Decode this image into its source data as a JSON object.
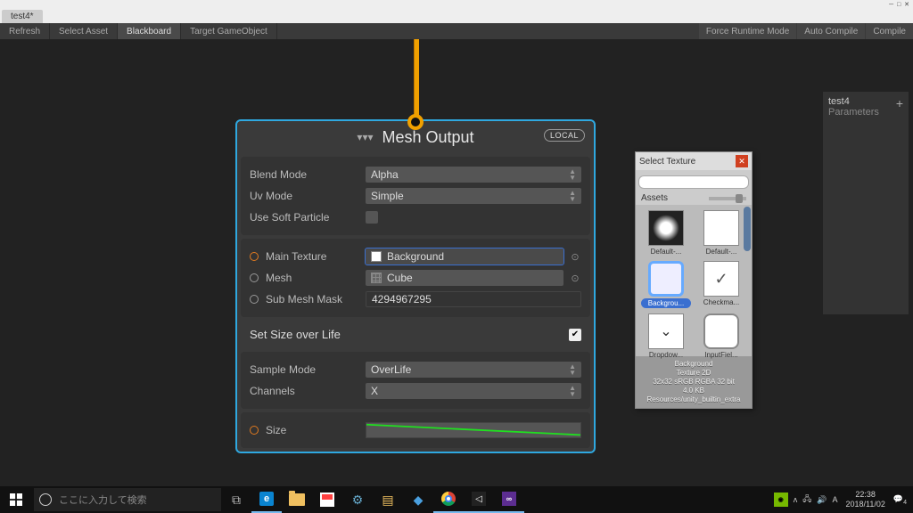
{
  "window": {
    "tab": "test4*"
  },
  "toolbar": {
    "left": [
      "Refresh",
      "Select Asset",
      "Blackboard",
      "Target GameObject"
    ],
    "active_index": 2,
    "right": [
      "Force Runtime Mode",
      "Auto Compile",
      "Compile"
    ]
  },
  "node": {
    "title": "Mesh Output",
    "badge": "LOCAL",
    "rows": {
      "blend_mode_label": "Blend Mode",
      "blend_mode_value": "Alpha",
      "uv_mode_label": "Uv Mode",
      "uv_mode_value": "Simple",
      "soft_particle_label": "Use Soft Particle",
      "soft_particle_checked": false,
      "main_texture_label": "Main Texture",
      "main_texture_value": "Background",
      "mesh_label": "Mesh",
      "mesh_value": "Cube",
      "submesh_label": "Sub Mesh Mask",
      "submesh_value": "4294967295"
    },
    "section": {
      "title": "Set Size over Life",
      "enabled": true,
      "sample_mode_label": "Sample Mode",
      "sample_mode_value": "OverLife",
      "channels_label": "Channels",
      "channels_value": "X",
      "size_label": "Size"
    }
  },
  "inspector": {
    "title": "test4",
    "subtitle": "Parameters"
  },
  "picker": {
    "title": "Select Texture",
    "search_placeholder": "",
    "tab": "Assets",
    "items": [
      {
        "label": "Default-...",
        "kind": "dark-particle"
      },
      {
        "label": "Default-...",
        "kind": "white"
      },
      {
        "label": "Backgrou...",
        "kind": "blue-rounded",
        "selected": true
      },
      {
        "label": "Checkma...",
        "kind": "checkmark"
      },
      {
        "label": "Dropdow...",
        "kind": "dropdown"
      },
      {
        "label": "InputFiel...",
        "kind": "rounded-white"
      }
    ],
    "footer": {
      "name": "Background",
      "type": "Texture 2D",
      "dims": "32x32 sRGB  RGBA 32 bit",
      "size": "4.0 KB",
      "path": "Resources/unity_builtin_extra"
    }
  },
  "taskbar": {
    "search_placeholder": "ここに入力して検索",
    "clock_time": "22:38",
    "clock_date": "2018/11/02",
    "ime": "A",
    "notif_count": "4"
  }
}
